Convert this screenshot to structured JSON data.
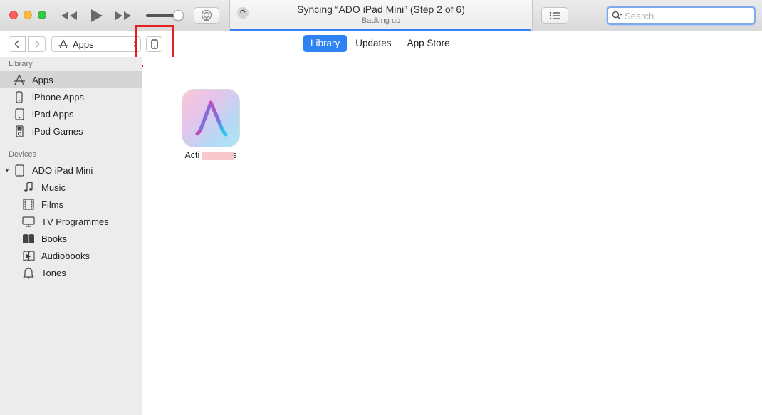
{
  "toolbar": {
    "lcd_title": "Syncing “ADO iPad Mini” (Step 2 of 6)",
    "lcd_subtitle": "Backing up",
    "progress_fraction": 0.998,
    "volume_level": 0.86,
    "search_placeholder": "Search"
  },
  "navbar": {
    "media_kind": "Apps",
    "tabs": [
      {
        "label": "Library",
        "active": true
      },
      {
        "label": "Updates",
        "active": false
      },
      {
        "label": "App Store",
        "active": false
      }
    ]
  },
  "sidebar": {
    "library_header": "Library",
    "library_items": [
      {
        "label": "Apps",
        "icon": "apps-icon",
        "selected": true
      },
      {
        "label": "iPhone Apps",
        "icon": "iphone-icon"
      },
      {
        "label": "iPad Apps",
        "icon": "ipad-icon"
      },
      {
        "label": "iPod Games",
        "icon": "ipod-icon"
      }
    ],
    "devices_header": "Devices",
    "device_name": "ADO iPad Mini",
    "device_items": [
      {
        "label": "Music",
        "icon": "music-note-icon"
      },
      {
        "label": "Films",
        "icon": "film-icon"
      },
      {
        "label": "TV Programmes",
        "icon": "tv-icon"
      },
      {
        "label": "Books",
        "icon": "book-icon"
      },
      {
        "label": "Audiobooks",
        "icon": "audiobook-icon"
      },
      {
        "label": "Tones",
        "icon": "bell-icon"
      }
    ]
  },
  "main": {
    "app_label_visible": "Acti"
  },
  "colors": {
    "accent": "#2d83f3",
    "highlight": "#e5211d"
  }
}
